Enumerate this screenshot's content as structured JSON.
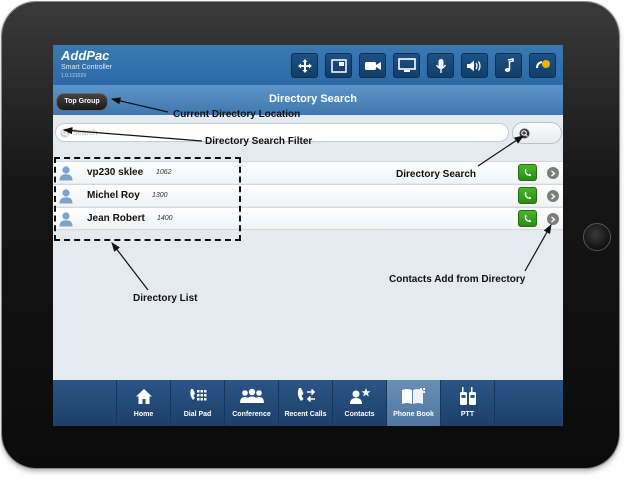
{
  "app": {
    "brand": "AddPac",
    "product": "Smart Controller",
    "version": "1.0.121029"
  },
  "toolbar": {
    "icons": [
      "move-icon",
      "layout-icon",
      "camera-icon",
      "monitor-icon",
      "microphone-icon",
      "speaker-icon",
      "music-note-icon",
      "call-status-icon"
    ]
  },
  "header": {
    "title": "Directory Search",
    "group_button": "Top Group"
  },
  "search": {
    "placeholder": "Search"
  },
  "directory": {
    "entries": [
      {
        "name": "vp230 sklee",
        "ext": "1062"
      },
      {
        "name": "Michel Roy",
        "ext": "1300"
      },
      {
        "name": "Jean Robert",
        "ext": "1400"
      }
    ]
  },
  "nav": {
    "tabs": [
      {
        "label": "Home",
        "icon": "home-icon"
      },
      {
        "label": "Dial Pad",
        "icon": "dial-pad-icon"
      },
      {
        "label": "Conference",
        "icon": "conference-icon"
      },
      {
        "label": "Recent Calls",
        "icon": "recent-calls-icon"
      },
      {
        "label": "Contacts",
        "icon": "contacts-icon"
      },
      {
        "label": "Phone Book",
        "icon": "phone-book-icon",
        "active": true
      },
      {
        "label": "PTT",
        "icon": "ptt-icon"
      }
    ]
  },
  "annotations": {
    "current_location": "Current Directory Location",
    "search_filter": "Directory Search Filter",
    "directory_search": "Directory Search",
    "contacts_add": "Contacts Add from Directory",
    "directory_list": "Directory List"
  },
  "colors": {
    "header_blue": "#2c6aa6",
    "call_green": "#3aa021",
    "nav_dark": "#1d3f69"
  }
}
